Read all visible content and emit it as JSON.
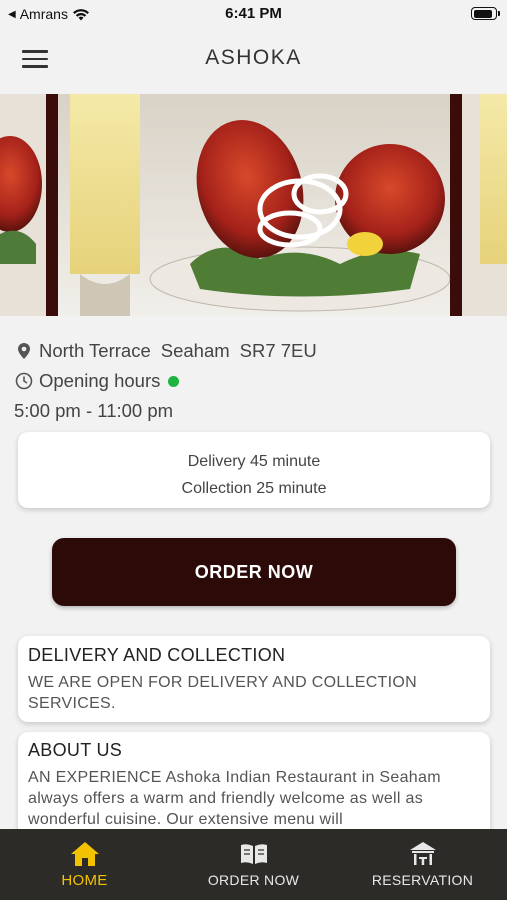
{
  "status_bar": {
    "carrier": "Amrans",
    "time": "6:41 PM",
    "battery_level": 0.9
  },
  "header": {
    "title": "ASHOKA"
  },
  "restaurant": {
    "address_street": "North Terrace",
    "address_town": "Seaham",
    "address_postcode": "SR7 7EU",
    "opening_label": "Opening hours",
    "open_status_color": "#1db33d",
    "hours": "5:00 pm - 11:00 pm"
  },
  "times": {
    "delivery": "Delivery 45 minute",
    "collection": "Collection 25 minute"
  },
  "order_button": {
    "label": "ORDER NOW"
  },
  "delivery_card": {
    "title": "DELIVERY AND COLLECTION",
    "text": "WE ARE OPEN FOR DELIVERY AND COLLECTION SERVICES."
  },
  "about_card": {
    "title": "ABOUT US",
    "text": "AN EXPERIENCE Ashoka Indian Restaurant in Seaham always offers a warm and friendly welcome as well as wonderful cuisine. Our extensive menu will"
  },
  "tabbar": {
    "tabs": [
      {
        "label": "HOME",
        "icon": "home-icon",
        "active": true
      },
      {
        "label": "ORDER NOW",
        "icon": "menu-book-icon",
        "active": false
      },
      {
        "label": "RESERVATION",
        "icon": "reservation-icon",
        "active": false
      }
    ],
    "active_color": "#f2c200",
    "background": "#2d2b27"
  },
  "colors": {
    "brand_dark": "#2c0a08",
    "background": "#f2f2f2"
  }
}
